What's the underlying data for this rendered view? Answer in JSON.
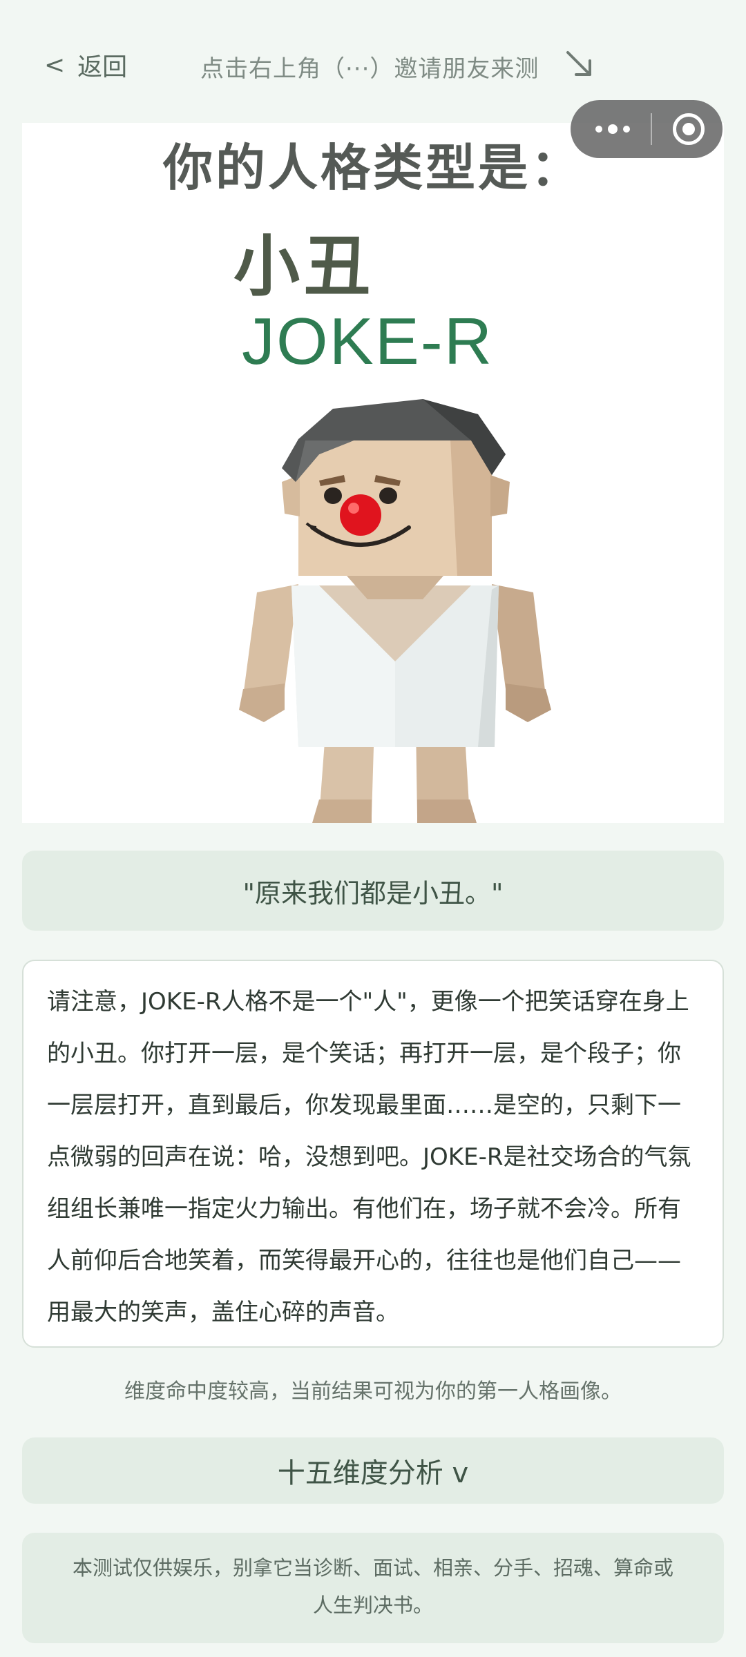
{
  "nav": {
    "back_label": "返回",
    "back_chevron": "<",
    "invite_hint": "点击右上角（···）邀请朋友来测",
    "arrow_icon": "arrow-down-right-icon",
    "capsule": {
      "menu_icon": "more-dots-icon",
      "close_icon": "target-close-icon"
    }
  },
  "result_image": {
    "title": "你的人格类型是：",
    "type_name": "小丑",
    "type_code": "JOKE-R",
    "figure_icon": "clown-figure-illustration"
  },
  "quote": "\"原来我们都是小丑。\"",
  "description": "请注意，JOKE-R人格不是一个\"人\"，更像一个把笑话穿在身上的小丑。你打开一层，是个笑话；再打开一层，是个段子；你一层层打开，直到最后，你发现最里面……是空的，只剩下一点微弱的回声在说：哈，没想到吧。JOKE-R是社交场合的气氛组组长兼唯一指定火力输出。有他们在，场子就不会冷。所有人前仰后合地笑着，而笑得最开心的，往往也是他们自己——用最大的笑声，盖住心碎的声音。",
  "confidence_note": "维度命中度较高，当前结果可视为你的第一人格画像。",
  "dimension_button": "十五维度分析 v",
  "disclaimer": "本测试仅供娱乐，别拿它当诊断、面试、相亲、分手、招魂、算命或人生判决书。",
  "colors": {
    "background": "#f2f7f3",
    "card_green": "#e3ede5",
    "code_green": "#2e7c52",
    "clown_nose": "#e0141e"
  }
}
